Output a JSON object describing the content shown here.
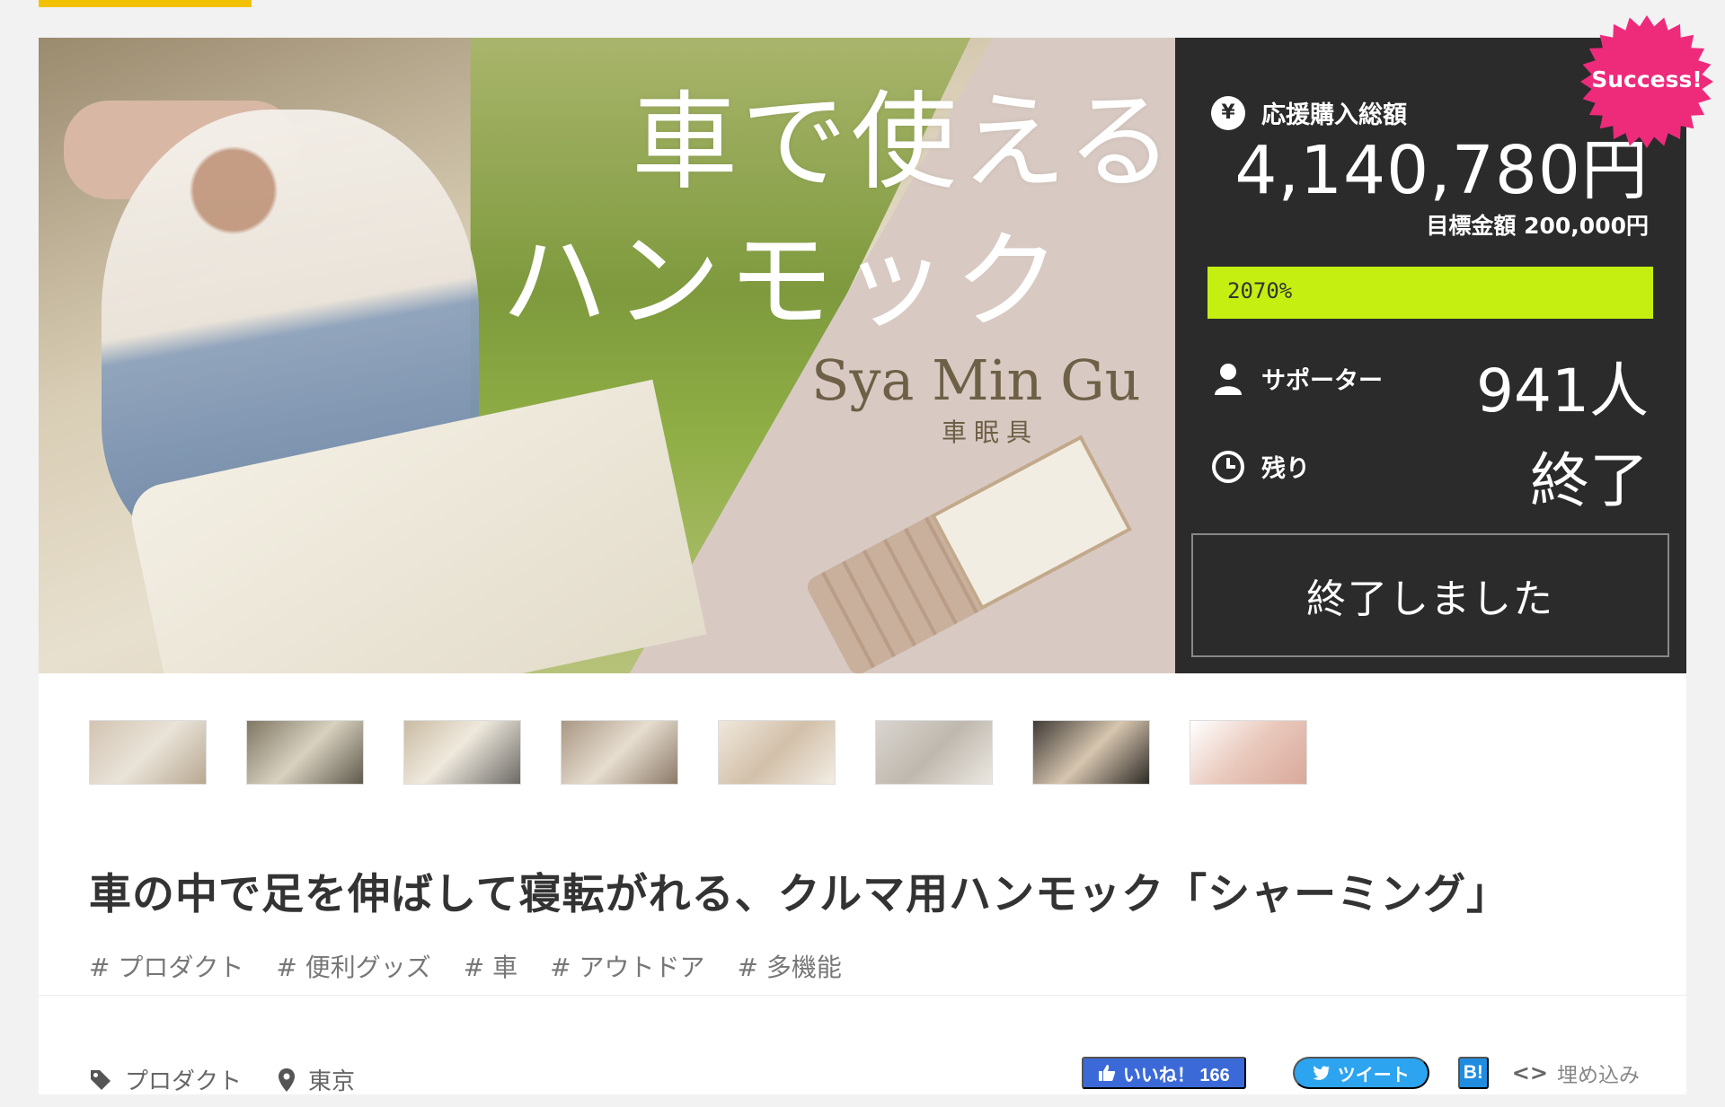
{
  "hero": {
    "title_line1": "車で使える",
    "title_line2": "ハンモック",
    "brand": "Sya Min Gu",
    "brand_sub": "車眠具"
  },
  "stats": {
    "amount_label": "応援購入総額",
    "amount": "4,140,780円",
    "goal": "目標金額 200,000円",
    "progress_text": "2070%",
    "progress_fraction": 1.0,
    "supporters_label": "サポーター",
    "supporters": "941人",
    "remain_label": "残り",
    "remain": "終了",
    "status_button": "終了しました",
    "success_badge": "Success!",
    "accent_progress": "#c4ef10",
    "badge_color": "#ee2a7b"
  },
  "thumbnails": [
    {
      "icon": "thumbnail-image"
    },
    {
      "icon": "thumbnail-image"
    },
    {
      "icon": "thumbnail-image"
    },
    {
      "icon": "thumbnail-image"
    },
    {
      "icon": "thumbnail-image"
    },
    {
      "icon": "thumbnail-image"
    },
    {
      "icon": "thumbnail-image"
    },
    {
      "icon": "thumbnail-image"
    }
  ],
  "project": {
    "title": "車の中で足を伸ばして寝転がれる、クルマ用ハンモック「シャーミング」",
    "tags": [
      "# プロダクト",
      "# 便利グッズ",
      "# 車",
      "# アウトドア",
      "# 多機能"
    ],
    "category": "プロダクト",
    "location": "東京"
  },
  "social": {
    "fb_label": "いいね！ 166",
    "tw_label": "ツイート",
    "hb_label": "B!",
    "embed_label": "埋め込み"
  }
}
